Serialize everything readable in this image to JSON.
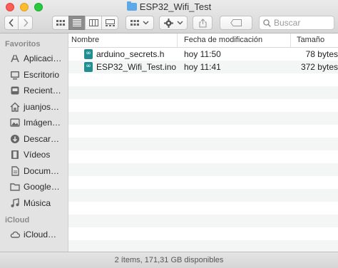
{
  "window": {
    "title": "ESP32_Wifi_Test"
  },
  "search": {
    "placeholder": "Buscar"
  },
  "sidebar": {
    "sections": [
      {
        "heading": "Favoritos",
        "items": [
          {
            "label": "Aplicaci…",
            "icon": "applications-icon"
          },
          {
            "label": "Escritorio",
            "icon": "desktop-icon"
          },
          {
            "label": "Recient…",
            "icon": "recents-icon"
          },
          {
            "label": "juanjos…",
            "icon": "home-icon"
          },
          {
            "label": "Imágen…",
            "icon": "pictures-icon"
          },
          {
            "label": "Descar…",
            "icon": "downloads-icon"
          },
          {
            "label": "Vídeos",
            "icon": "movies-icon"
          },
          {
            "label": "Docum…",
            "icon": "documents-icon"
          },
          {
            "label": "Google…",
            "icon": "folder-icon"
          },
          {
            "label": "Música",
            "icon": "music-icon"
          }
        ]
      },
      {
        "heading": "iCloud",
        "items": [
          {
            "label": "iCloud…",
            "icon": "icloud-icon"
          }
        ]
      }
    ]
  },
  "columns": {
    "name": "Nombre",
    "date": "Fecha de modificación",
    "size": "Tamaño"
  },
  "files": [
    {
      "name": "arduino_secrets.h",
      "date": "hoy 11:50",
      "size": "78 bytes",
      "icon": "arduino-file-icon"
    },
    {
      "name": "ESP32_Wifi_Test.ino",
      "date": "hoy 11:41",
      "size": "372 bytes",
      "icon": "arduino-file-icon"
    }
  ],
  "status": {
    "text": "2 ítems, 171,31 GB disponibles"
  }
}
